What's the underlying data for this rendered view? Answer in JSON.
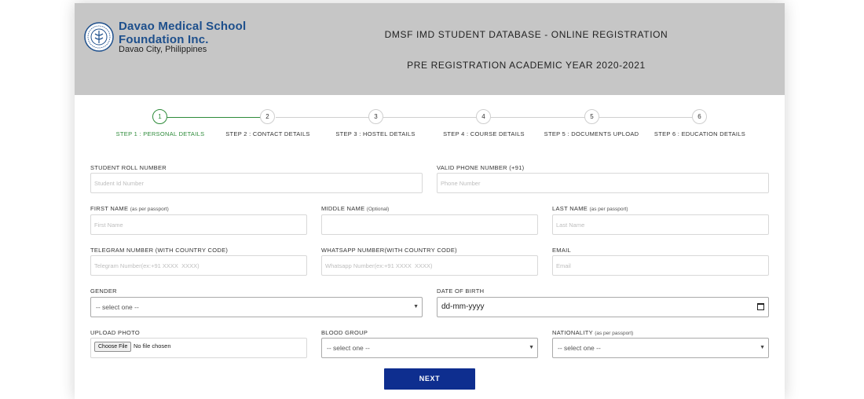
{
  "brand": {
    "line1": "Davao Medical School",
    "line2": "Foundation Inc.",
    "line3": "Davao City, Philippines"
  },
  "header": {
    "title": "DMSF IMD STUDENT DATABASE - ONLINE REGISTRATION",
    "subtitle": "PRE REGISTRATION ACADEMIC YEAR 2020-2021"
  },
  "stepper": {
    "steps": [
      {
        "num": "1",
        "label": "STEP 1 : PERSONAL DETAILS"
      },
      {
        "num": "2",
        "label": "STEP 2 : CONTACT DETAILS"
      },
      {
        "num": "3",
        "label": "STEP 3 : HOSTEL DETAILS"
      },
      {
        "num": "4",
        "label": "STEP 4 : COURSE DETAILS"
      },
      {
        "num": "5",
        "label": "STEP 5 : DOCUMENTS UPLOAD"
      },
      {
        "num": "6",
        "label": "STEP 6 : EDUCATION DETAILS"
      }
    ],
    "active_step": 1
  },
  "form": {
    "roll_number": {
      "label": "STUDENT ROLL NUMBER",
      "placeholder": "Student Id Number"
    },
    "phone": {
      "label": "VALID PHONE NUMBER (+91)",
      "placeholder": "Phone Number"
    },
    "first_name": {
      "label": "FIRST NAME",
      "hint": "(as per passport)",
      "placeholder": "First Name"
    },
    "middle_name": {
      "label": "MIDDLE NAME",
      "hint": "(Optional)",
      "placeholder": ""
    },
    "last_name": {
      "label": "LAST NAME",
      "hint": "(as per passport)",
      "placeholder": "Last Name"
    },
    "telegram": {
      "label": "TELEGRAM NUMBER (WITH COUNTRY CODE)",
      "placeholder": "Telegram Number(ex:+91 XXXX  XXXX)"
    },
    "whatsapp": {
      "label": "WHATSAPP NUMBER(WITH COUNTRY CODE)",
      "placeholder": "Whatsapp Number(ex:+91 XXXX  XXXX)"
    },
    "email": {
      "label": "EMAIL",
      "placeholder": "Email"
    },
    "gender": {
      "label": "GENDER",
      "selected": "-- select one --"
    },
    "dob": {
      "label": "DATE OF BIRTH",
      "value": "dd-mm-yyyy"
    },
    "photo": {
      "label": "UPLOAD PHOTO",
      "button": "Choose File",
      "status": "No file chosen"
    },
    "blood_group": {
      "label": "BLOOD GROUP",
      "selected": "-- select one --"
    },
    "nationality": {
      "label": "NATIONALITY",
      "hint": "(as per passport)",
      "selected": "-- select one --"
    },
    "next_label": "NEXT"
  },
  "colors": {
    "header_bg": "#c6c6c6",
    "brand_blue": "#1d4f8c",
    "step_active": "#2e8b3a",
    "button_bg": "#0e2e8f"
  }
}
